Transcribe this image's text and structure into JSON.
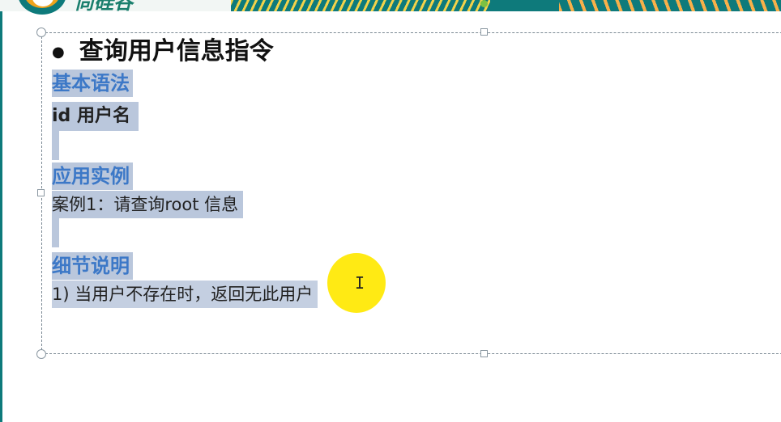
{
  "slide": {
    "heading": "查询用户信息指令",
    "sections": {
      "syntax_title": "基本语法",
      "syntax_command": "id 用户名",
      "example_title": "应用实例",
      "example_text": "案例1：请查询root  信息",
      "detail_title": "细节说明",
      "detail_text": "1) 当用户不存在时，返回无此用户"
    }
  },
  "colors": {
    "section_title": "#3c78c7",
    "selection_highlight": "#bac7dc",
    "cursor_highlight": "#ffe800",
    "banner": "#0e7a7b"
  },
  "icons": {
    "cursor": "ibeam-cursor-icon",
    "bullet": "bullet-dot-icon"
  }
}
